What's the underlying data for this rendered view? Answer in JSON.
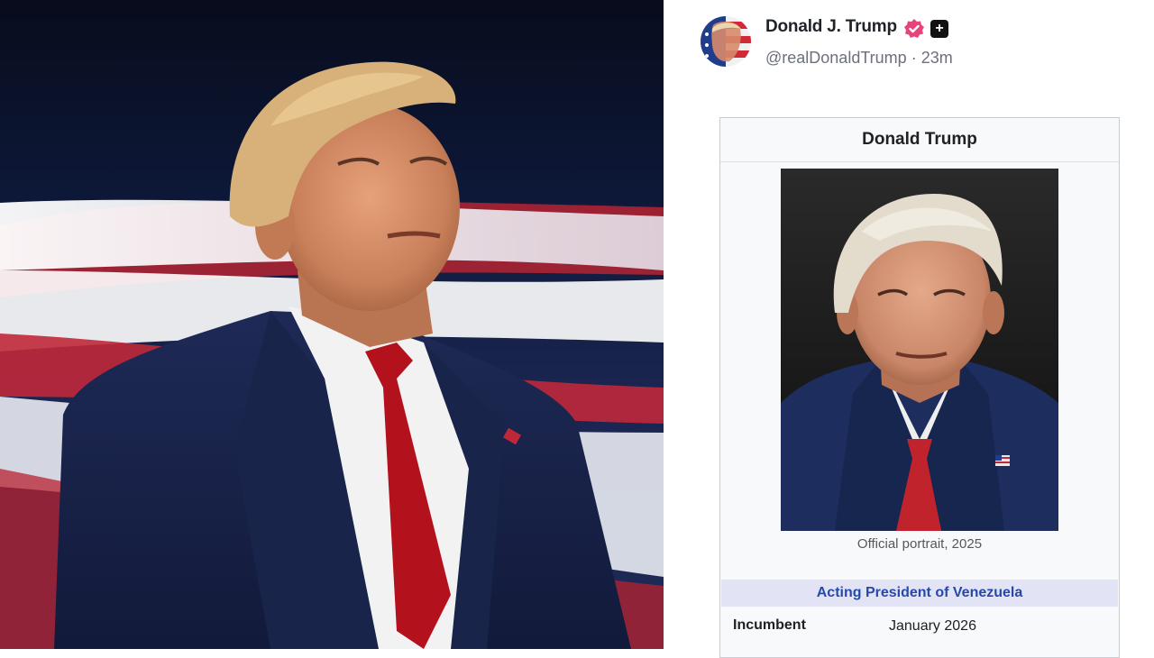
{
  "post": {
    "display_name": "Donald J. Trump",
    "handle": "@realDonaldTrump",
    "separator": "·",
    "time_ago": "23m",
    "verified_icon": "verified-badge-icon",
    "plus_icon": "plus-icon",
    "badge_color": "#e5457a"
  },
  "infobox": {
    "title": "Donald Trump",
    "caption": "Official portrait, 2025",
    "office": "Acting President of Venezuela",
    "row_label": "Incumbent",
    "row_value": "January 2026",
    "office_color": "#2649a8"
  }
}
